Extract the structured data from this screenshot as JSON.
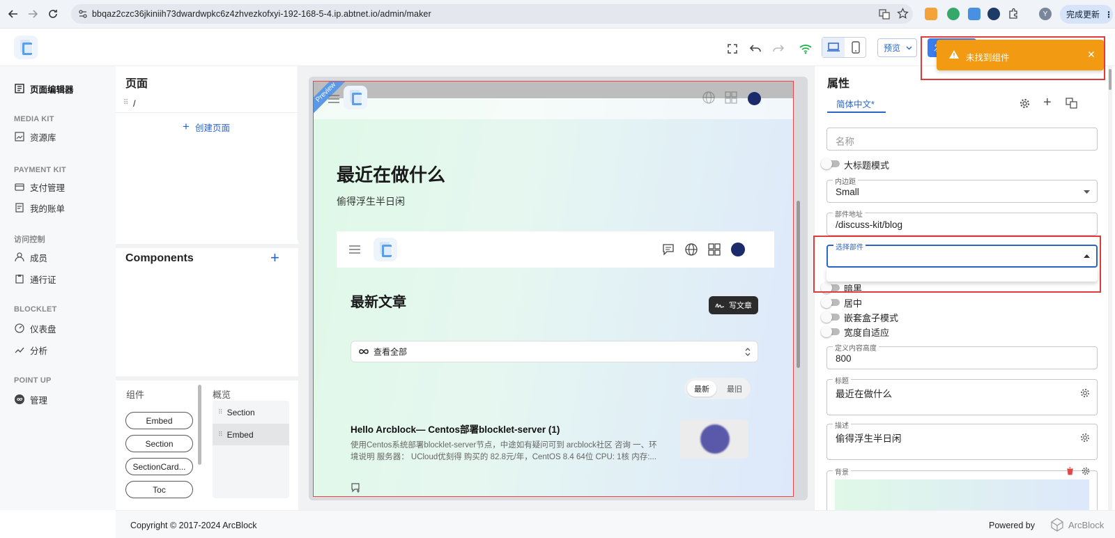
{
  "browser": {
    "url": "bbqaz2czc36jkiniih73dwardwpkc6z4zhvezkofxyi-192-168-5-4.ip.abtnet.io/admin/maker",
    "update_label": "完成更新"
  },
  "header": {
    "preview_label": "预览",
    "publish_label": "发布"
  },
  "left_nav": {
    "page_editor": "页面编辑器",
    "sections": [
      {
        "title": "MEDIA KIT",
        "items": [
          "资源库"
        ]
      },
      {
        "title": "PAYMENT KIT",
        "items": [
          "支付管理",
          "我的账单"
        ]
      },
      {
        "title": "访问控制",
        "items": [
          "成员",
          "通行证"
        ]
      },
      {
        "title": "BLOCKLET",
        "items": [
          "仪表盘",
          "分析"
        ]
      },
      {
        "title": "POINT UP",
        "items": [
          "管理"
        ]
      }
    ]
  },
  "pages_panel": {
    "title": "页面",
    "page_path": "/",
    "create_label": "创建页面"
  },
  "components_panel": {
    "title": "Components"
  },
  "bottom_panel": {
    "components_title": "组件",
    "overview_title": "概览",
    "chips": [
      "Embed",
      "Section",
      "SectionCard...",
      "Toc"
    ],
    "overview_items": [
      "Section",
      "Embed"
    ]
  },
  "preview": {
    "ribbon": "Preview",
    "heading": "最近在做什么",
    "subheading": "偷得浮生半日闲",
    "blog_title": "最新文章",
    "write_label": "写文章",
    "filter_label": "查看全部",
    "sort_new": "最新",
    "sort_old": "最旧",
    "post_title": "Hello Arcblock— Centos部署blocklet-server (1)",
    "post_excerpt_1": "使用Centos系统部署blocklet-server节点，中途如有疑问可到 arcblock社区 咨询 一、环",
    "post_excerpt_2": "境说明 服务器： UCloud优刻得 购买的 82.8元/年，CentOS 8.4 64位 CPU: 1核 内存:..."
  },
  "props": {
    "title": "属性",
    "locale_tab": "简体中文*",
    "name_placeholder": "名称",
    "switch_bigtitle": "大标题模式",
    "padding_label": "内边距",
    "padding_value": "Small",
    "component_url_label": "部件地址",
    "component_url_value": "/discuss-kit/blog",
    "select_component_label": "选择部件",
    "switch_dark": "暗黑",
    "switch_center": "居中",
    "switch_nested": "嵌套盒子模式",
    "switch_width": "宽度自适应",
    "content_height_label": "定义内容高度",
    "content_height_value": "800",
    "title_label": "标题",
    "title_value": "最近在做什么",
    "desc_label": "描述",
    "desc_value": "偷得浮生半日闲",
    "bg_label": "背景"
  },
  "toast": {
    "message": "未找到组件",
    "color": "#f29a12"
  },
  "footer": {
    "copyright": "Copyright © 2017-2024  ArcBlock",
    "powered_by": "Powered by",
    "brand": "ArcBlock"
  },
  "colors": {
    "accent": "#3a7df0",
    "highlight": "#e03a3a"
  }
}
